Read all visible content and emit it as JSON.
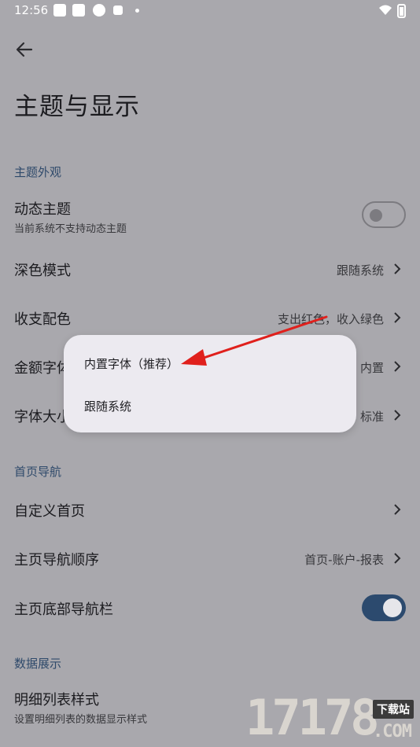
{
  "status_bar": {
    "time": "12:56"
  },
  "page": {
    "title": "主题与显示"
  },
  "sections": {
    "theme_appearance": "主题外观",
    "home_navigation": "首页导航",
    "data_display": "数据展示"
  },
  "settings": {
    "dynamic_theme": {
      "title": "动态主题",
      "subtitle": "当前系统不支持动态主题",
      "enabled": false
    },
    "dark_mode": {
      "title": "深色模式",
      "value": "跟随系统"
    },
    "income_expense_color": {
      "title": "收支配色",
      "value": "支出红色，收入绿色"
    },
    "amount_font": {
      "title": "金额字体",
      "value": "内置"
    },
    "font_size": {
      "title": "字体大小",
      "value": "标准"
    },
    "custom_home": {
      "title": "自定义首页"
    },
    "home_nav_order": {
      "title": "主页导航顺序",
      "value": "首页-账户-报表"
    },
    "home_bottom_nav": {
      "title": "主页底部导航栏",
      "enabled": true
    },
    "detail_list_style": {
      "title": "明细列表样式",
      "subtitle": "设置明细列表的数据显示样式"
    }
  },
  "popup_menu": {
    "options": [
      "内置字体（推荐）",
      "跟随系统"
    ]
  },
  "annotation": {
    "color": "#e0201c"
  },
  "watermark": {
    "digits": "17178",
    "tag": "下载站",
    "domain": ".COM"
  },
  "icons": {
    "back": "arrow-left-icon",
    "chevron": "chevron-right-icon",
    "wifi": "wifi-icon",
    "battery": "battery-icon"
  },
  "colors": {
    "background": "#a9a8ad",
    "section_header": "#2f4a6b",
    "switch_on": "#2c4a6e",
    "popup_bg": "#eceaf0"
  }
}
